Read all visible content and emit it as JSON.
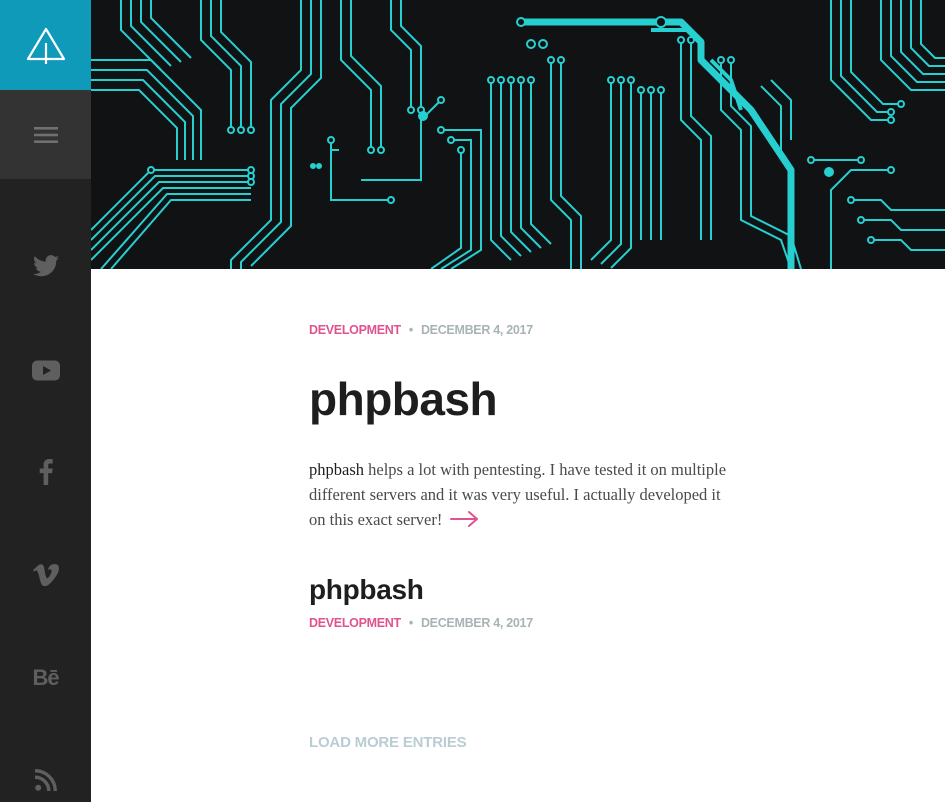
{
  "sidebar": {
    "logo_icon": "triangle-arrow-logo-icon",
    "menu_icon": "hamburger-menu-icon",
    "social": [
      {
        "name": "twitter",
        "icon": "twitter-icon"
      },
      {
        "name": "youtube",
        "icon": "youtube-icon"
      },
      {
        "name": "facebook",
        "icon": "facebook-icon"
      },
      {
        "name": "vimeo",
        "icon": "vimeo-icon"
      },
      {
        "name": "behance",
        "icon": "behance-icon",
        "text": "Bē"
      },
      {
        "name": "rss",
        "icon": "rss-icon"
      }
    ],
    "colors": {
      "background": "#222222",
      "accent": "#0e9ab8",
      "icon": "#5f5f5f"
    }
  },
  "hero": {
    "image": "circuit-board-banner",
    "colors": {
      "background": "#111214",
      "trace": "#26cfd0"
    }
  },
  "posts": [
    {
      "category": "DEVELOPMENT",
      "separator": "•",
      "date": "DECEMBER 4, 2017",
      "title": "phpbash",
      "excerpt_strong": "phpbash",
      "excerpt_rest": " helps a lot with pentesting. I have tested it on multiple different servers and it was very useful. I actually developed it on this exact server!",
      "readmore_icon": "arrow-right-icon"
    },
    {
      "title": "phpbash",
      "category": "DEVELOPMENT",
      "separator": "•",
      "date": "DECEMBER 4, 2017"
    }
  ],
  "load_more": "LOAD MORE ENTRIES",
  "colors": {
    "category": "#e0538e",
    "date": "#a8b3b6",
    "title": "#1e1e1e",
    "load_more": "#b9cdd3"
  }
}
